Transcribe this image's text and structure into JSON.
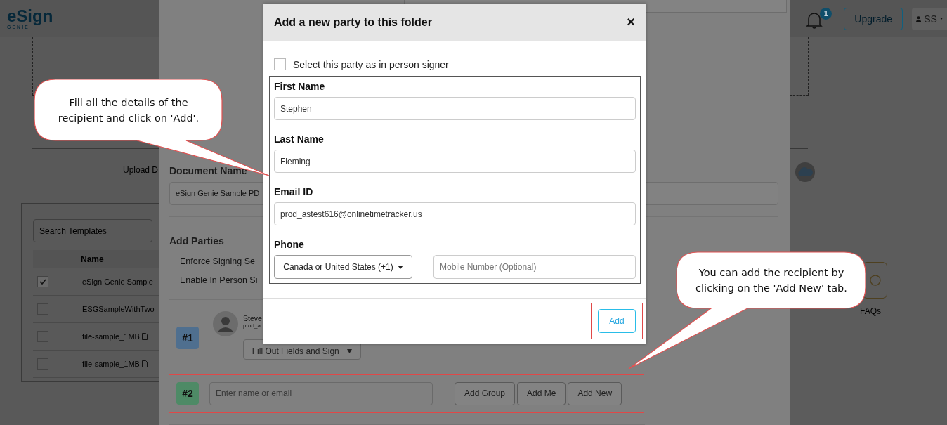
{
  "header": {
    "logo_word": "eSign",
    "logo_tagline": "GENIE",
    "notification_count": "1",
    "upgrade_button": "Upgrade",
    "user": "SS"
  },
  "background": {
    "upload_label": "Upload D",
    "search": {
      "placeholder": "Search Templates"
    },
    "table": {
      "columns": [
        "Name"
      ],
      "rows": [
        {
          "name": "eSign Genie Sample",
          "checked": true,
          "file_icon": false
        },
        {
          "name": "ESGSampleWithTwo",
          "checked": false,
          "file_icon": false
        },
        {
          "name": "file-sample_1MB",
          "checked": false,
          "file_icon": true
        },
        {
          "name": "file-sample_1MB",
          "checked": false,
          "file_icon": true
        }
      ]
    },
    "faqs_label": "FAQs"
  },
  "document_panel": {
    "document_name_label": "Document Name",
    "document_name_value": "eSign Genie Sample PD",
    "add_parties_label": "Add Parties",
    "options": [
      "Enforce Signing Se",
      "Enable In Person Si"
    ],
    "parties": [
      {
        "kind": "assigned",
        "number": "#1",
        "color": "#4f6f8f",
        "name": "Steve",
        "email": "prod_a",
        "role": "Fill Out Fields and Sign"
      },
      {
        "kind": "empty",
        "number": "#2",
        "color": "#4e8a66",
        "placeholder": "Enter name or email",
        "buttons": [
          "Add Group",
          "Add Me",
          "Add New"
        ]
      }
    ]
  },
  "dialog": {
    "title": "Add a new party to this folder",
    "close": "×",
    "in_person": {
      "label": "Select this party as in person signer",
      "checked": false
    },
    "fields": [
      {
        "label": "First Name",
        "value": "Stephen"
      },
      {
        "label": "Last Name",
        "value": "Fleming"
      },
      {
        "label": "Email ID",
        "value": "prod_astest616@onlinetimetracker.us"
      }
    ],
    "phone": {
      "label": "Phone",
      "country": "Canada or United States (+1)",
      "placeholder": "Mobile Number (Optional)"
    },
    "add_button": "Add"
  },
  "callouts": [
    {
      "text": "Fill all the details of the recipient and click on 'Add'."
    },
    {
      "text": "You can add the recipient by clicking on the 'Add New' tab."
    }
  ]
}
